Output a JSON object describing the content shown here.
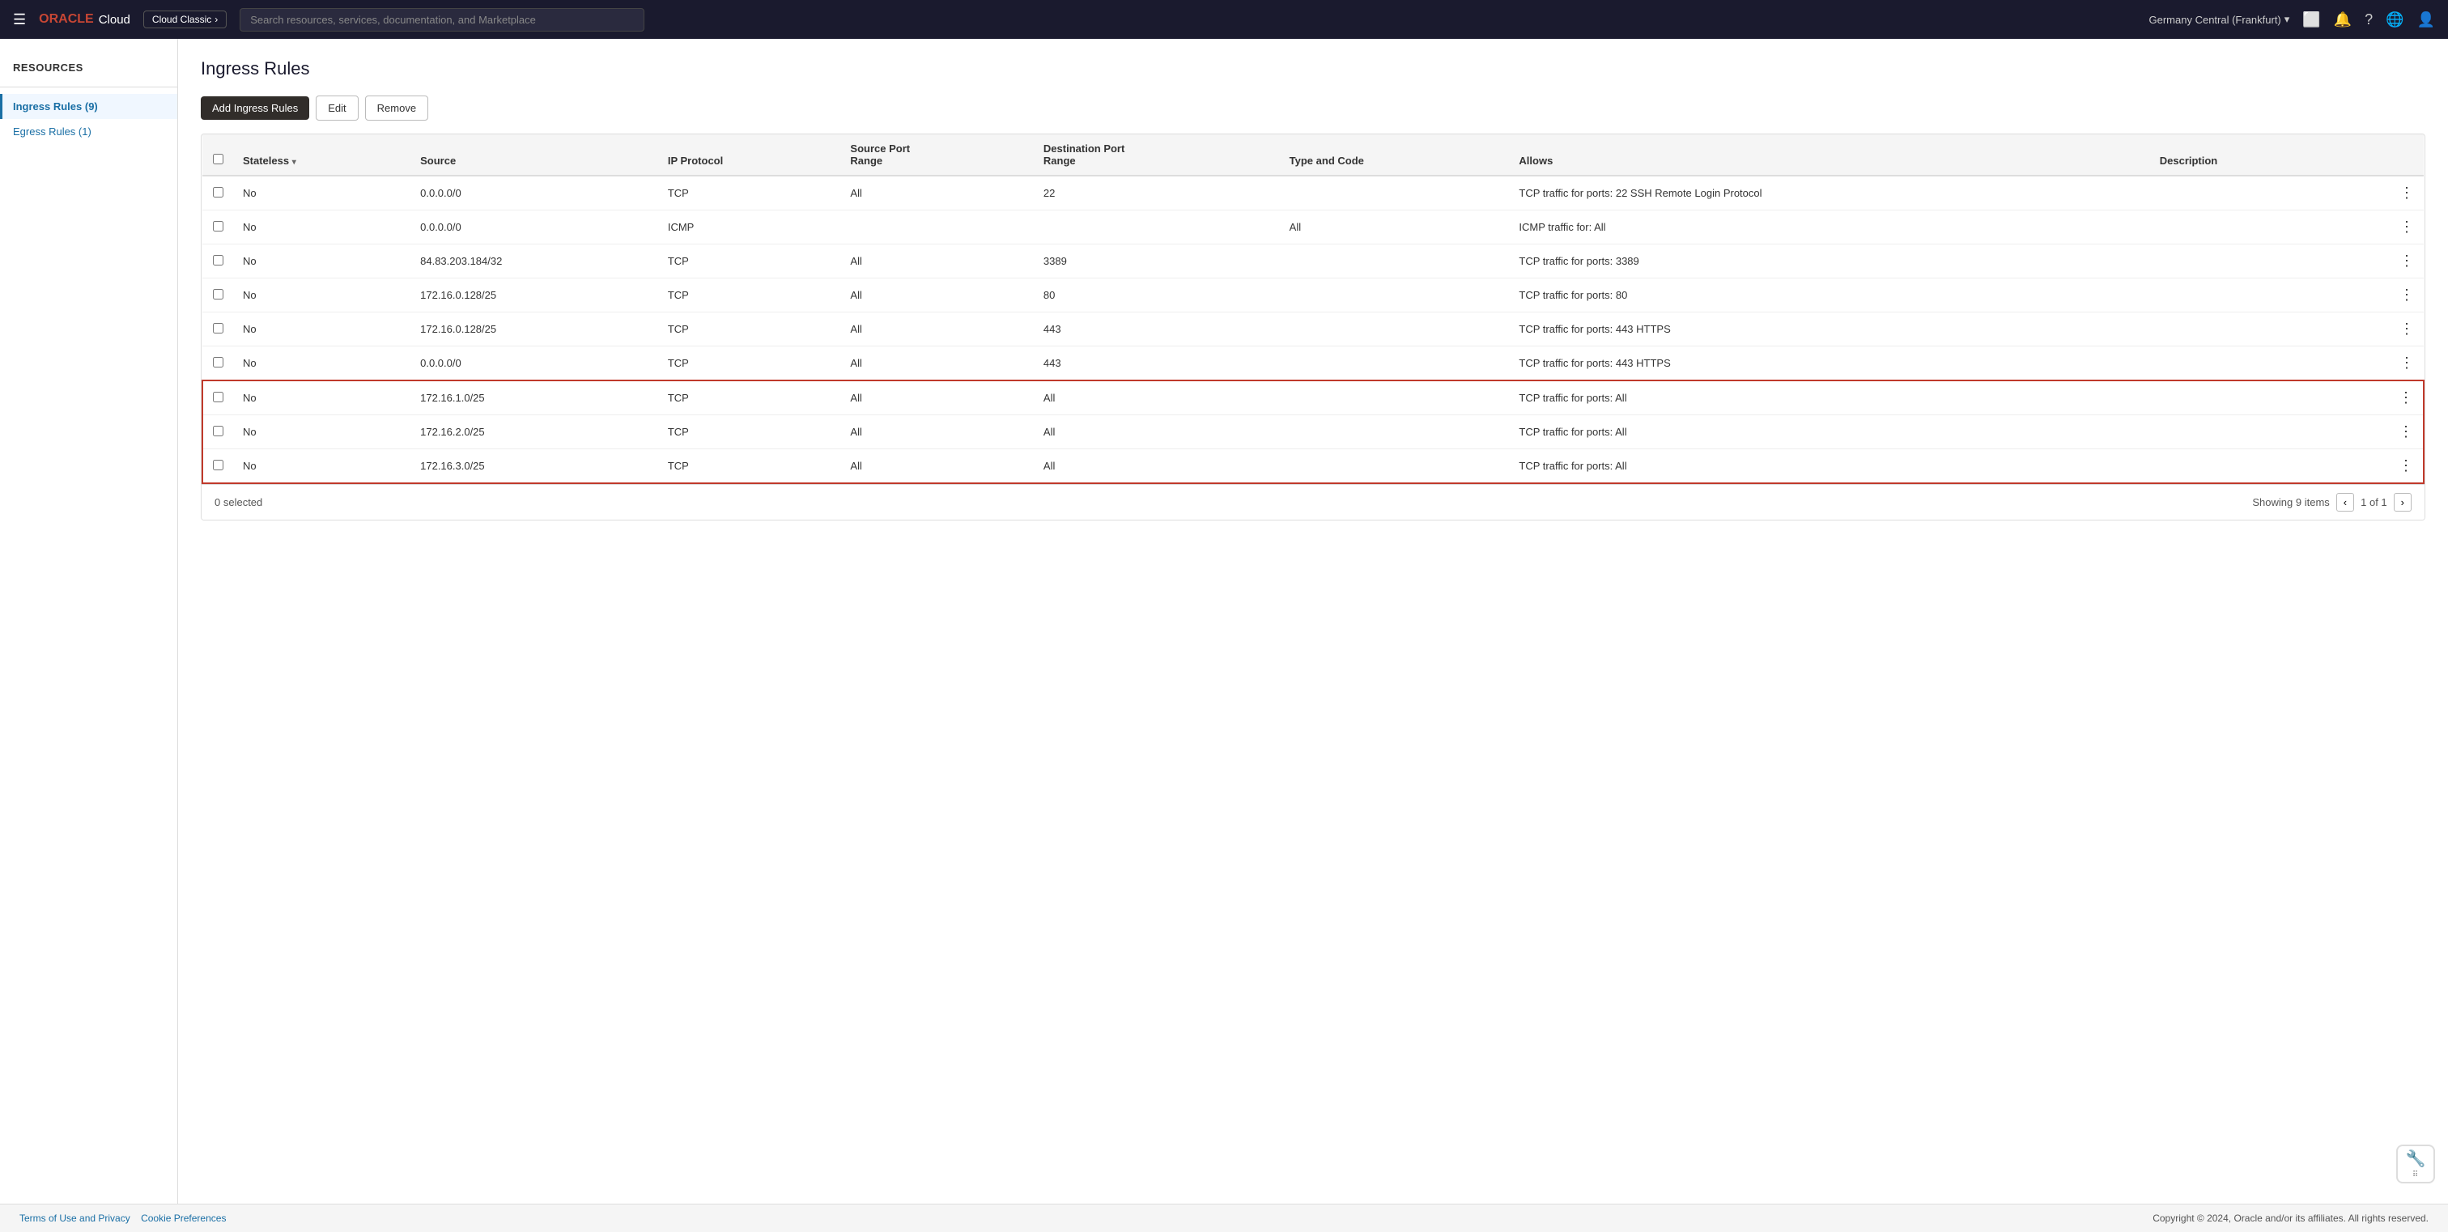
{
  "topnav": {
    "menu_icon": "☰",
    "oracle_label": "ORACLE",
    "cloud_label": "Cloud",
    "cloud_classic_label": "Cloud Classic",
    "cloud_classic_arrow": "›",
    "search_placeholder": "Search resources, services, documentation, and Marketplace",
    "region_label": "Germany Central (Frankfurt)",
    "region_chevron": "▾",
    "icons": [
      "⬜",
      "🔔",
      "?",
      "🌐",
      "👤"
    ]
  },
  "sidebar": {
    "section_title": "Resources",
    "items": [
      {
        "label": "Ingress Rules (9)",
        "active": true
      },
      {
        "label": "Egress Rules (1)",
        "active": false
      }
    ]
  },
  "main": {
    "page_title": "Ingress Rules",
    "toolbar": {
      "add_label": "Add Ingress Rules",
      "edit_label": "Edit",
      "remove_label": "Remove"
    },
    "table": {
      "columns": [
        {
          "key": "checkbox",
          "label": ""
        },
        {
          "key": "stateless",
          "label": "Stateless",
          "sortable": true
        },
        {
          "key": "source",
          "label": "Source"
        },
        {
          "key": "ip_protocol",
          "label": "IP Protocol"
        },
        {
          "key": "source_port_range",
          "label": "Source Port Range"
        },
        {
          "key": "destination_port_range",
          "label": "Destination Port Range"
        },
        {
          "key": "type_and_code",
          "label": "Type and Code"
        },
        {
          "key": "allows",
          "label": "Allows"
        },
        {
          "key": "description",
          "label": "Description"
        },
        {
          "key": "actions",
          "label": ""
        }
      ],
      "rows": [
        {
          "stateless": "No",
          "source": "0.0.0.0/0",
          "ip_protocol": "TCP",
          "source_port_range": "All",
          "destination_port_range": "22",
          "type_and_code": "",
          "allows": "TCP traffic for ports: 22 SSH Remote Login Protocol",
          "description": "",
          "highlighted": false
        },
        {
          "stateless": "No",
          "source": "0.0.0.0/0",
          "ip_protocol": "ICMP",
          "source_port_range": "",
          "destination_port_range": "",
          "type_and_code": "All",
          "allows": "ICMP traffic for: All",
          "description": "",
          "highlighted": false
        },
        {
          "stateless": "No",
          "source": "84.83.203.184/32",
          "ip_protocol": "TCP",
          "source_port_range": "All",
          "destination_port_range": "3389",
          "type_and_code": "",
          "allows": "TCP traffic for ports: 3389",
          "description": "",
          "highlighted": false
        },
        {
          "stateless": "No",
          "source": "172.16.0.128/25",
          "ip_protocol": "TCP",
          "source_port_range": "All",
          "destination_port_range": "80",
          "type_and_code": "",
          "allows": "TCP traffic for ports: 80",
          "description": "",
          "highlighted": false
        },
        {
          "stateless": "No",
          "source": "172.16.0.128/25",
          "ip_protocol": "TCP",
          "source_port_range": "All",
          "destination_port_range": "443",
          "type_and_code": "",
          "allows": "TCP traffic for ports: 443 HTTPS",
          "description": "",
          "highlighted": false
        },
        {
          "stateless": "No",
          "source": "0.0.0.0/0",
          "ip_protocol": "TCP",
          "source_port_range": "All",
          "destination_port_range": "443",
          "type_and_code": "",
          "allows": "TCP traffic for ports: 443 HTTPS",
          "description": "",
          "highlighted": false
        },
        {
          "stateless": "No",
          "source": "172.16.1.0/25",
          "ip_protocol": "TCP",
          "source_port_range": "All",
          "destination_port_range": "All",
          "type_and_code": "",
          "allows": "TCP traffic for ports: All",
          "description": "",
          "highlighted": true
        },
        {
          "stateless": "No",
          "source": "172.16.2.0/25",
          "ip_protocol": "TCP",
          "source_port_range": "All",
          "destination_port_range": "All",
          "type_and_code": "",
          "allows": "TCP traffic for ports: All",
          "description": "",
          "highlighted": true
        },
        {
          "stateless": "No",
          "source": "172.16.3.0/25",
          "ip_protocol": "TCP",
          "source_port_range": "All",
          "destination_port_range": "All",
          "type_and_code": "",
          "allows": "TCP traffic for ports: All",
          "description": "",
          "highlighted": true
        }
      ]
    },
    "footer": {
      "selected_label": "0 selected",
      "showing_label": "Showing 9 items",
      "page_label": "1 of 1",
      "prev_btn": "‹",
      "next_btn": "›"
    }
  },
  "bottom_bar": {
    "left_links": [
      "Terms of Use and Privacy",
      "Cookie Preferences"
    ],
    "copyright": "Copyright © 2024, Oracle and/or its affiliates. All rights reserved."
  },
  "help_widget": {
    "icon": "⊙",
    "dots": "⠿"
  }
}
